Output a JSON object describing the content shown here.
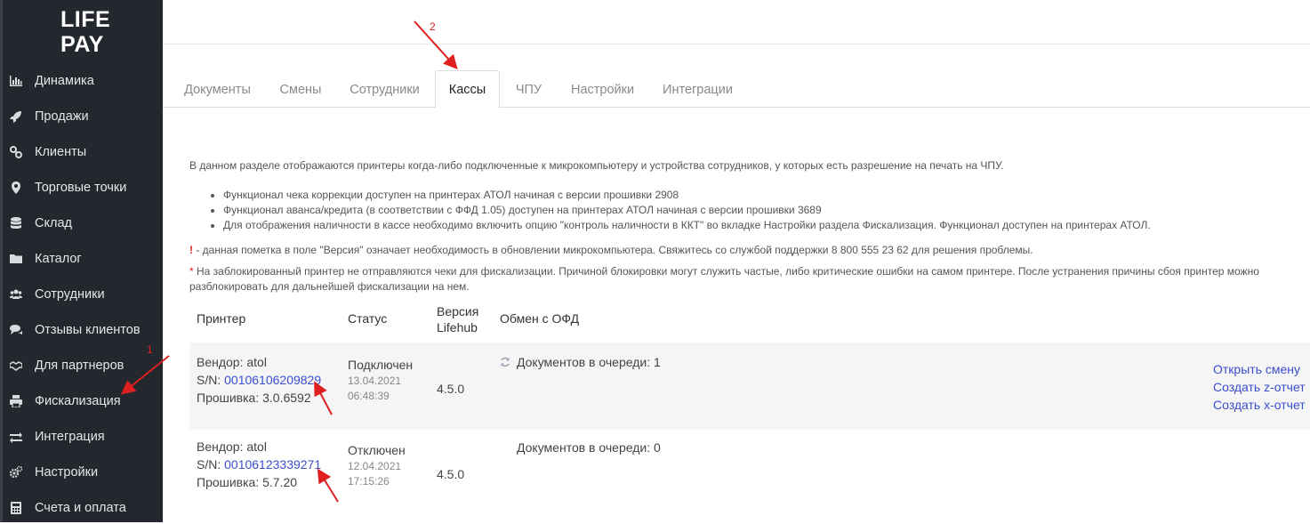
{
  "logo": {
    "line1": "LIFE",
    "line2": "PAY"
  },
  "sidebar": {
    "items": [
      {
        "label": "Динамика",
        "icon": "bar-chart-icon"
      },
      {
        "label": "Продажи",
        "icon": "rocket-icon"
      },
      {
        "label": "Клиенты",
        "icon": "link-icon"
      },
      {
        "label": "Торговые точки",
        "icon": "map-marker-icon"
      },
      {
        "label": "Склад",
        "icon": "database-icon"
      },
      {
        "label": "Каталог",
        "icon": "folder-icon"
      },
      {
        "label": "Сотрудники",
        "icon": "users-icon"
      },
      {
        "label": "Отзывы клиентов",
        "icon": "comments-icon"
      },
      {
        "label": "Для партнеров",
        "icon": "handshake-icon"
      },
      {
        "label": "Фискализация",
        "icon": "printer-icon"
      },
      {
        "label": "Интеграция",
        "icon": "exchange-icon"
      },
      {
        "label": "Настройки",
        "icon": "cogs-icon"
      },
      {
        "label": "Счета и оплата",
        "icon": "calculator-icon"
      }
    ]
  },
  "tabs": [
    {
      "label": "Документы"
    },
    {
      "label": "Смены"
    },
    {
      "label": "Сотрудники"
    },
    {
      "label": "Кассы",
      "active": true
    },
    {
      "label": "ЧПУ"
    },
    {
      "label": "Настройки"
    },
    {
      "label": "Интеграции"
    }
  ],
  "content": {
    "intro": "В данном разделе отображаются принтеры когда-либо подключенные к микрокомпьютеру и устройства сотрудников, у которых есть разрешение на печать на ЧПУ.",
    "bullets": [
      "Функционал чека коррекции доступен на принтерах АТОЛ начиная с версии прошивки 2908",
      "Функционал аванса/кредита (в соответствии с ФФД 1.05) доступен на принтерах АТОЛ начиная с версии прошивки 3689",
      "Для отображения наличности в кассе необходимо включить опцию \"контроль наличности в ККТ\" во вкладке Настройки раздела Фискализация. Функционал доступен на принтерах АТОЛ."
    ],
    "warn_mark": "!",
    "warn_text": " - данная пометка в поле \"Версия\" означает необходимость в обновлении микрокомпьютера. Свяжитесь со службой поддержки 8 800 555 23 62 для решения проблемы.",
    "star_mark": "*",
    "star_text": " На заблокированный принтер не отправляются чеки для фискализации. Причиной блокировки могут служить частые, либо критические ошибки на самом принтере. После устранения причины сбоя принтер можно разблокировать для дальнейшей фискализации на нем."
  },
  "table": {
    "headers": {
      "printer": "Принтер",
      "status": "Статус",
      "version_line1": "Версия",
      "version_line2": "Lifehub",
      "ofd": "Обмен с ОФД"
    },
    "rows": [
      {
        "vendor": "Вендор: atol",
        "sn_label": "S/N: ",
        "sn": "00106106209829",
        "firmware": "Прошивка: 3.0.6592",
        "status": "Подключен",
        "date": "13.04.2021",
        "time": "06:48:39",
        "version": "4.5.0",
        "queue": "Документов в очереди: 1",
        "actions": [
          "Открыть смену",
          "Создать z-отчет",
          "Создать x-отчет"
        ]
      },
      {
        "vendor": "Вендор: atol",
        "sn_label": "S/N: ",
        "sn": "00106123339271",
        "firmware": "Прошивка: 5.7.20",
        "status": "Отключен",
        "date": "12.04.2021",
        "time": "17:15:26",
        "version": "4.5.0",
        "queue": "Документов в очереди: 0"
      }
    ]
  },
  "annotations": {
    "one": "1",
    "two": "2"
  },
  "colors": {
    "sidebar_bg": "#24272d",
    "link": "#3a4fcf",
    "annotation": "#e02020"
  }
}
